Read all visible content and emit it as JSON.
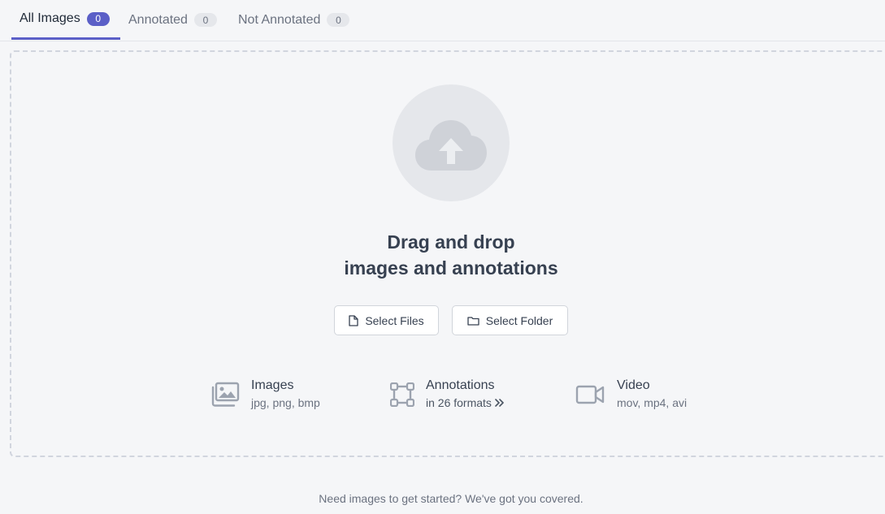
{
  "tabs": [
    {
      "label": "All Images",
      "count": "0"
    },
    {
      "label": "Annotated",
      "count": "0"
    },
    {
      "label": "Not Annotated",
      "count": "0"
    }
  ],
  "dropzone": {
    "headline_line1": "Drag and drop",
    "headline_line2": "images and annotations",
    "select_files_label": "Select Files",
    "select_folder_label": "Select Folder",
    "upload_icon": "cloud-upload-icon"
  },
  "features": {
    "images": {
      "title": "Images",
      "subtitle": "jpg, png, bmp",
      "icon": "images-icon"
    },
    "annotations": {
      "title": "Annotations",
      "subtitle": "in 26 formats",
      "icon": "bounding-box-icon",
      "more_icon": "double-chevron-right-icon"
    },
    "video": {
      "title": "Video",
      "subtitle": "mov, mp4, avi",
      "icon": "video-camera-icon"
    }
  },
  "footer": {
    "text": "Need images to get started? We've got you covered."
  },
  "colors": {
    "accent": "#5b5fc7",
    "background": "#f5f6f8",
    "icon_gray": "#9ca3af"
  }
}
